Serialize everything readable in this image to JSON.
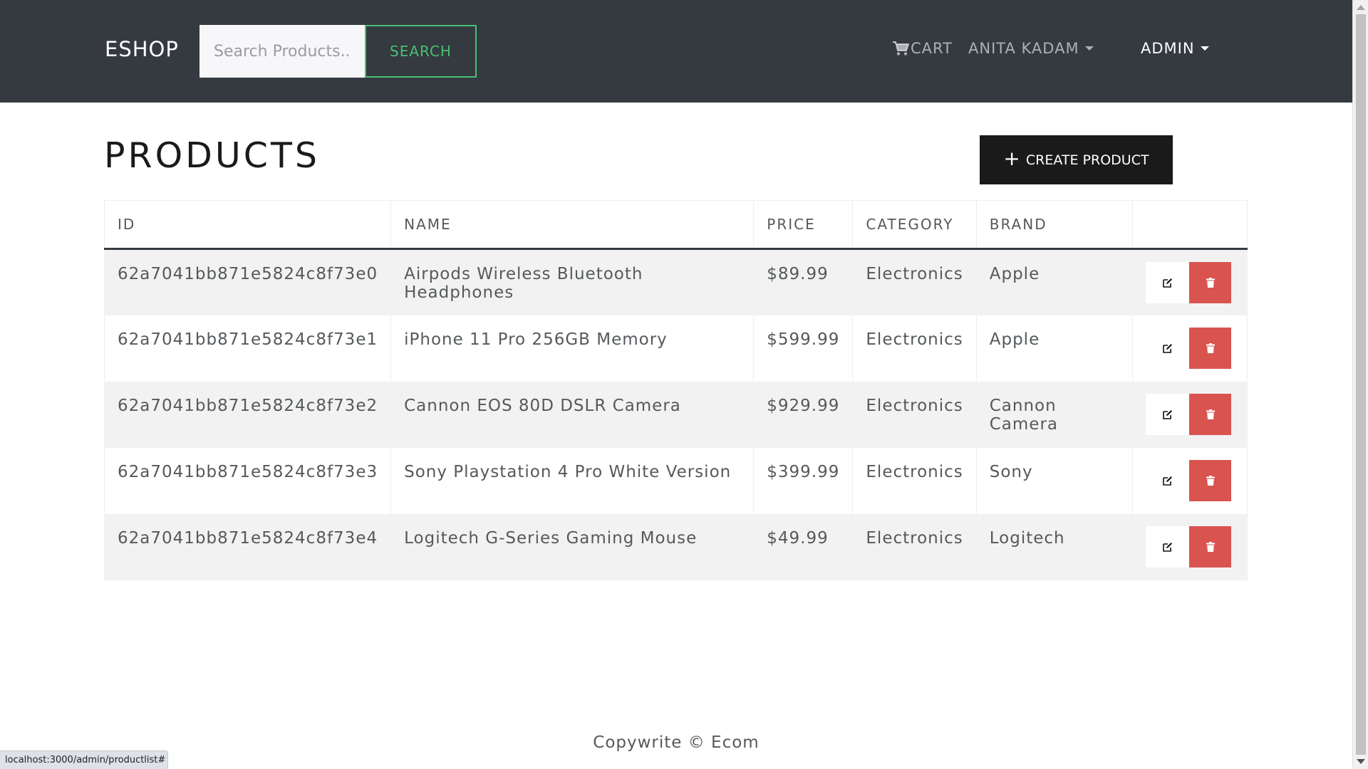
{
  "navbar": {
    "brand": "ESHOP",
    "search_placeholder": "Search Products...",
    "search_button": "SEARCH",
    "cart_label": "CART",
    "user_label": "ANITA KADAM",
    "admin_label": "ADMIN"
  },
  "page": {
    "title": "PRODUCTS",
    "create_button": "CREATE PRODUCT"
  },
  "table": {
    "headers": [
      "ID",
      "NAME",
      "PRICE",
      "CATEGORY",
      "BRAND",
      ""
    ],
    "rows": [
      {
        "id": "62a7041bb871e5824c8f73e0",
        "name": "Airpods Wireless Bluetooth Headphones",
        "price": "$89.99",
        "category": "Electronics",
        "brand": "Apple"
      },
      {
        "id": "62a7041bb871e5824c8f73e1",
        "name": "iPhone 11 Pro 256GB Memory",
        "price": "$599.99",
        "category": "Electronics",
        "brand": "Apple"
      },
      {
        "id": "62a7041bb871e5824c8f73e2",
        "name": "Cannon EOS 80D DSLR Camera",
        "price": "$929.99",
        "category": "Electronics",
        "brand": "Cannon Camera"
      },
      {
        "id": "62a7041bb871e5824c8f73e3",
        "name": "Sony Playstation 4 Pro White Version",
        "price": "$399.99",
        "category": "Electronics",
        "brand": "Sony"
      },
      {
        "id": "62a7041bb871e5824c8f73e4",
        "name": "Logitech G-Series Gaming Mouse",
        "price": "$49.99",
        "category": "Electronics",
        "brand": "Logitech"
      }
    ]
  },
  "footer": {
    "text": "Copywrite © Ecom"
  },
  "status_bar": {
    "url": "localhost:3000/admin/productlist#"
  },
  "icons": {
    "cart": "cart-icon",
    "edit": "edit-icon",
    "delete": "trash-icon",
    "create": "plus-icon"
  },
  "colors": {
    "navbar_bg": "#343a40",
    "search_accent": "#4bbf73",
    "delete_btn": "#d9534f",
    "create_btn": "#1a1a1a"
  }
}
